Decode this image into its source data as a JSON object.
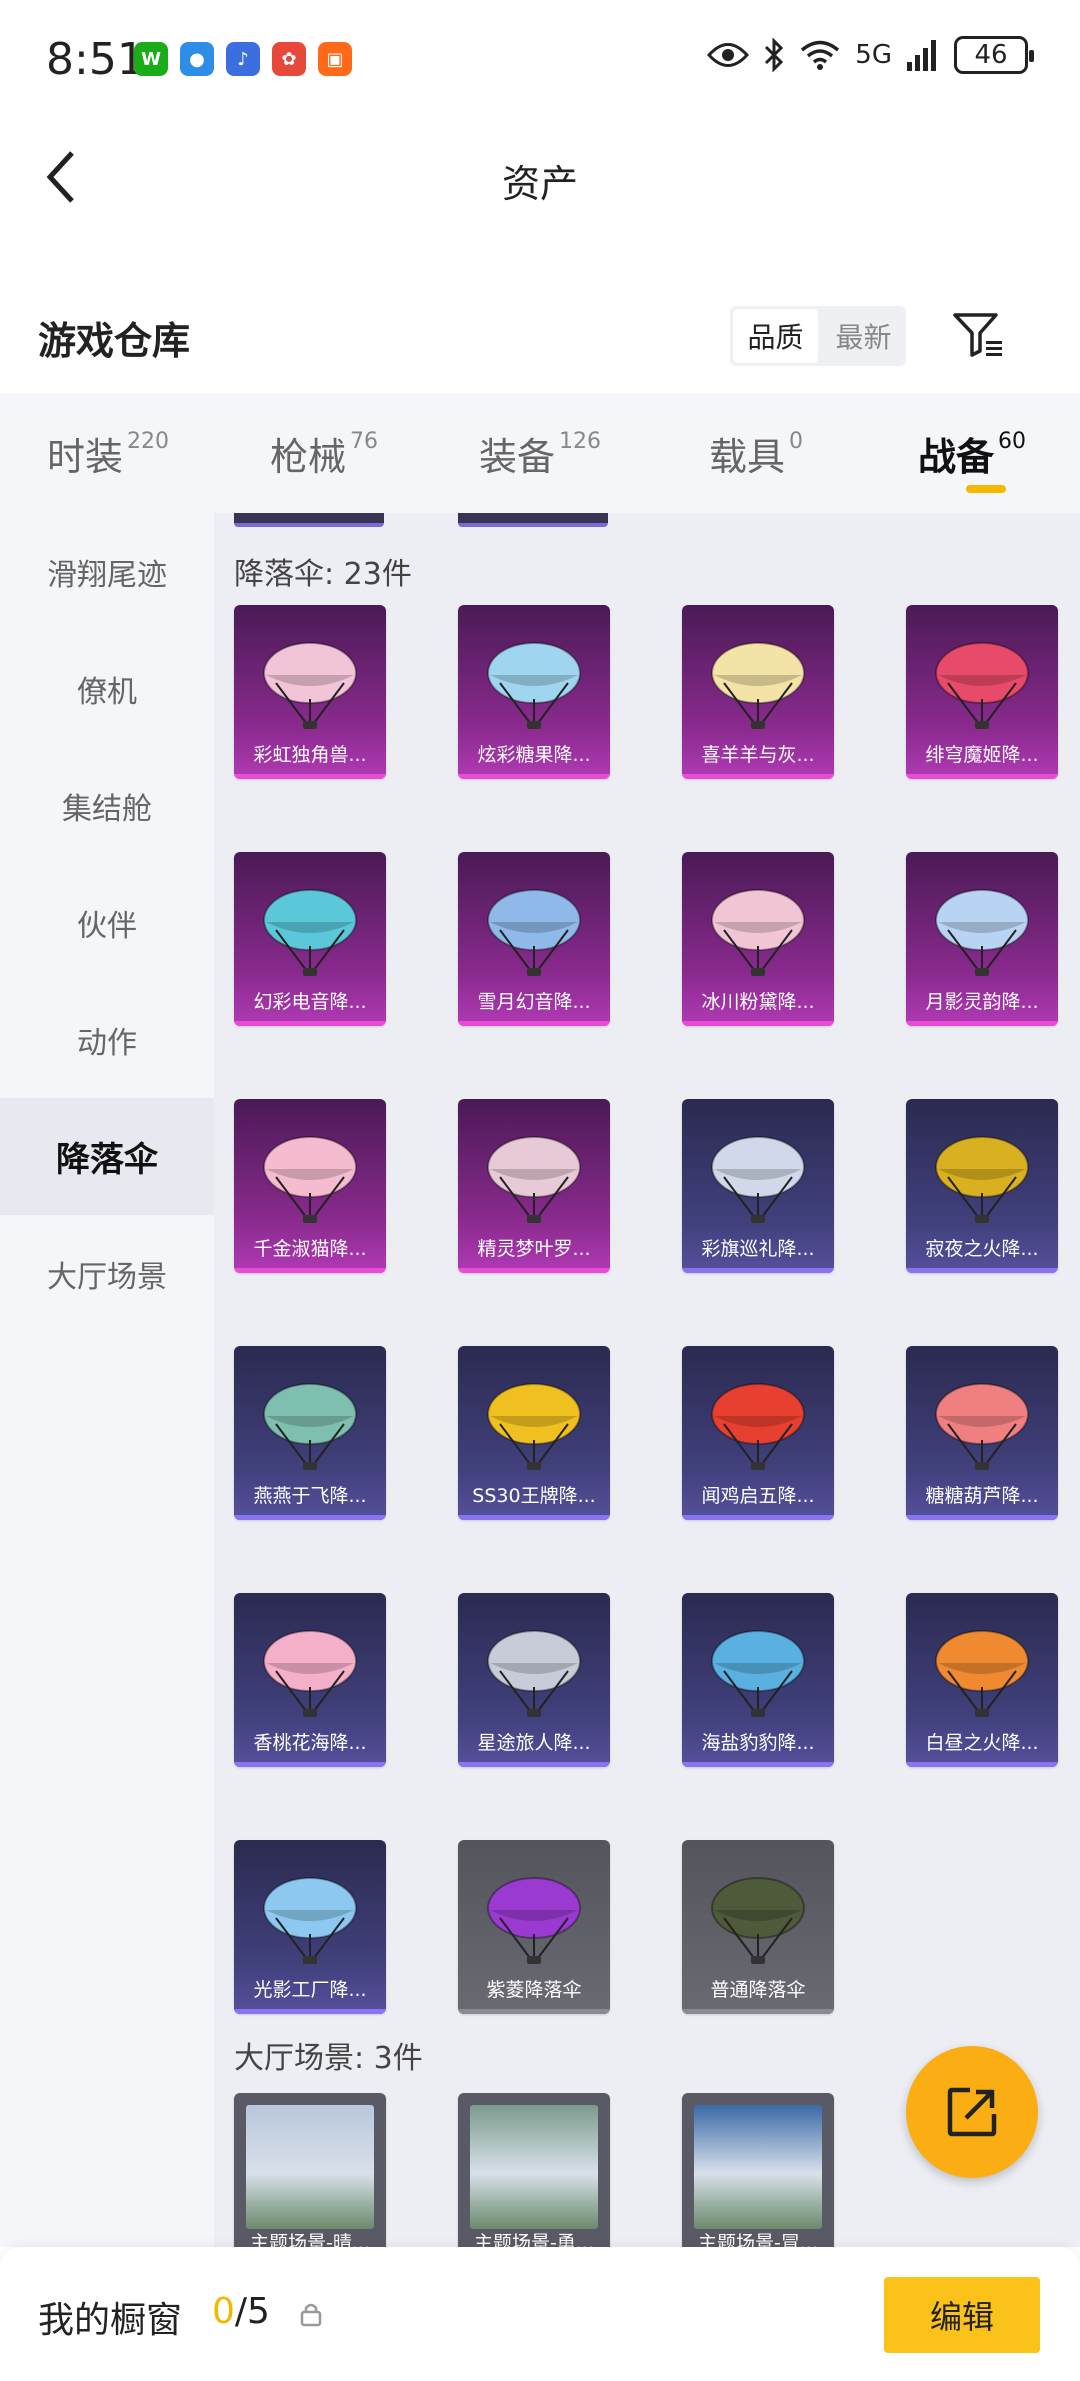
{
  "status_bar": {
    "time": "8:51",
    "network": "5G",
    "battery": "46",
    "apps": [
      {
        "icon": "wechat-icon",
        "color": "#1aad19",
        "glyph": "W"
      },
      {
        "icon": "browser-icon",
        "color": "#2e8de6",
        "glyph": "●"
      },
      {
        "icon": "music-icon",
        "color": "#3b6fe0",
        "glyph": "♪"
      },
      {
        "icon": "shopping-icon",
        "color": "#e8483a",
        "glyph": "✿"
      },
      {
        "icon": "orange-app-icon",
        "color": "#ff6a1a",
        "glyph": "▣"
      }
    ]
  },
  "header": {
    "title": "资产"
  },
  "warehouse": {
    "title": "游戏仓库",
    "sort_options": [
      "品质",
      "最新"
    ]
  },
  "tabs": [
    {
      "label": "时装",
      "count": "220"
    },
    {
      "label": "枪械",
      "count": "76"
    },
    {
      "label": "装备",
      "count": "126"
    },
    {
      "label": "载具",
      "count": "0"
    },
    {
      "label": "战备",
      "count": "60",
      "active": true
    }
  ],
  "sidebar": {
    "items": [
      "滑翔尾迹",
      "僚机",
      "集结舱",
      "伙伴",
      "动作",
      "降落伞",
      "大厅场景"
    ],
    "active_index": 5
  },
  "sections": {
    "parachute": {
      "title": "降落伞: 23件",
      "items": [
        {
          "name": "彩虹独角兽...",
          "rarity": "legend",
          "color": "#f2c4d8"
        },
        {
          "name": "炫彩糖果降...",
          "rarity": "legend",
          "color": "#9fd5ef"
        },
        {
          "name": "喜羊羊与灰...",
          "rarity": "legend",
          "color": "#f4e3a6"
        },
        {
          "name": "绯穹魔姬降...",
          "rarity": "legend",
          "color": "#e84a6a"
        },
        {
          "name": "幻彩电音降...",
          "rarity": "legend",
          "color": "#5ac8d8"
        },
        {
          "name": "雪月幻音降...",
          "rarity": "legend",
          "color": "#8fb9e8"
        },
        {
          "name": "冰川粉黛降...",
          "rarity": "legend",
          "color": "#f1c6d4"
        },
        {
          "name": "月影灵韵降...",
          "rarity": "legend",
          "color": "#b9d3f2"
        },
        {
          "name": "千金淑猫降...",
          "rarity": "legend",
          "color": "#f5bcd0"
        },
        {
          "name": "精灵梦叶罗...",
          "rarity": "legend",
          "color": "#e8c9d6"
        },
        {
          "name": "彩旗巡礼降...",
          "rarity": "epic",
          "color": "#d0d8ea"
        },
        {
          "name": "寂夜之火降...",
          "rarity": "epic",
          "color": "#d8b020"
        },
        {
          "name": "燕燕于飞降...",
          "rarity": "epic",
          "color": "#7fbfb0"
        },
        {
          "name": "SS30王牌降...",
          "rarity": "epic",
          "color": "#f0c020"
        },
        {
          "name": "闻鸡启五降...",
          "rarity": "epic",
          "color": "#e84030"
        },
        {
          "name": "糖糖葫芦降...",
          "rarity": "epic",
          "color": "#f08080"
        },
        {
          "name": "香桃花海降...",
          "rarity": "epic",
          "color": "#f4b0c8"
        },
        {
          "name": "星途旅人降...",
          "rarity": "epic",
          "color": "#c8ccd8"
        },
        {
          "name": "海盐豹豹降...",
          "rarity": "epic",
          "color": "#5ab0e0"
        },
        {
          "name": "白昼之火降...",
          "rarity": "epic",
          "color": "#f08a30"
        },
        {
          "name": "光影工厂降...",
          "rarity": "epic",
          "color": "#8cc8f0"
        },
        {
          "name": "紫菱降落伞",
          "rarity": "basic",
          "color": "#9a3ad0"
        },
        {
          "name": "普通降落伞",
          "rarity": "basic",
          "color": "#4e5a3a"
        }
      ]
    },
    "scene": {
      "title": "大厅场景: 3件",
      "items": [
        {
          "name": "主题场景-晴...",
          "color": "#b9c7dc"
        },
        {
          "name": "主题场景-勇...",
          "color": "#7c9a8c"
        },
        {
          "name": "主题场景-冒...",
          "color": "#3a6aa8"
        }
      ]
    }
  },
  "bottom_bar": {
    "label": "我的橱窗",
    "current": "0",
    "total": "/5",
    "edit_label": "编辑"
  },
  "accent_color": "#f5b800"
}
